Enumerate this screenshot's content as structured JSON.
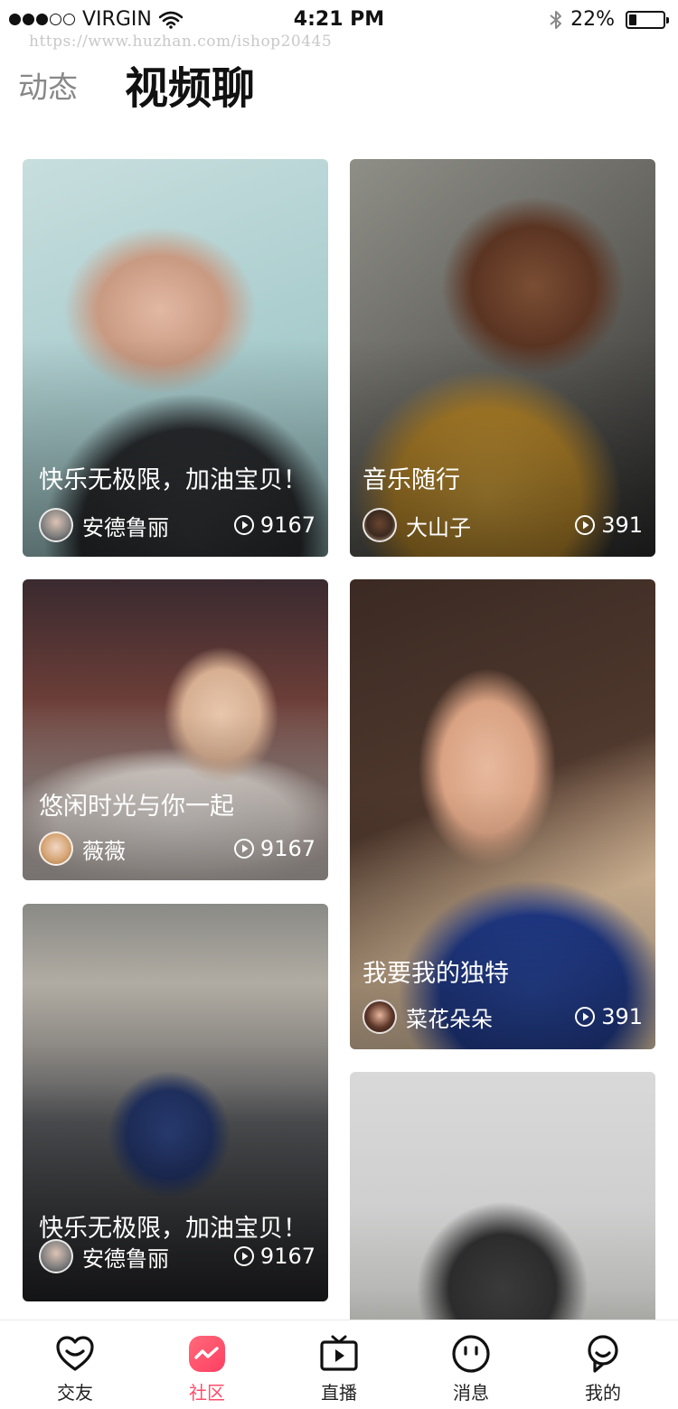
{
  "status_bar": {
    "carrier": "VIRGIN",
    "time": "4:21 PM",
    "battery_text": "22%",
    "battery_level": 0.22,
    "signal_bars_filled": 3,
    "signal_bars_total": 5
  },
  "watermark": "https://www.huzhan.com/ishop20445",
  "header": {
    "tab_inactive": "动态",
    "tab_active": "视频聊"
  },
  "feed": [
    {
      "title": "快乐无极限，加油宝贝！",
      "author": "安德鲁丽",
      "plays": "9167"
    },
    {
      "title": "音乐随行",
      "author": "大山子",
      "plays": "391"
    },
    {
      "title": "悠闲时光与你一起",
      "author": "薇薇",
      "plays": "9167"
    },
    {
      "title": "我要我的独特",
      "author": "菜花朵朵",
      "plays": "391"
    },
    {
      "title": "快乐无极限，加油宝贝！",
      "author": "安德鲁丽",
      "plays": "9167"
    }
  ],
  "tabbar": {
    "items": [
      {
        "label": "交友",
        "icon": "heart-smile-icon"
      },
      {
        "label": "社区",
        "icon": "community-wave-icon"
      },
      {
        "label": "直播",
        "icon": "tv-play-icon"
      },
      {
        "label": "消息",
        "icon": "face-message-icon"
      },
      {
        "label": "我的",
        "icon": "user-profile-icon"
      }
    ],
    "active_index": 1,
    "accent_color": "#ff4c6a"
  }
}
